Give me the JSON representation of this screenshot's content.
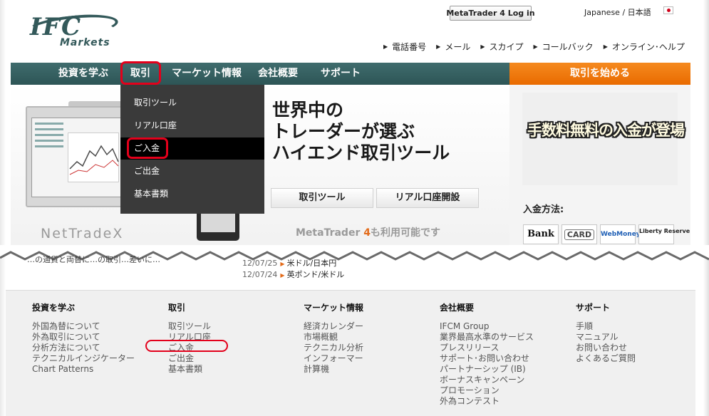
{
  "header": {
    "logo_text": "IFC",
    "logo_subtext": "Markets",
    "mt4_login": "MetaTrader 4 Log in",
    "language": "Japanese / 日本語",
    "top_links": [
      "電話番号",
      "メール",
      "スカイプ",
      "コールバック",
      "オンライン･ヘルプ"
    ]
  },
  "nav": {
    "items": [
      "投資を学ぶ",
      "取引",
      "マーケット情報",
      "会社概要",
      "サポート"
    ],
    "start_trading": "取引を始める"
  },
  "dropdown": {
    "items": [
      "取引ツール",
      "リアル口座",
      "ご入金",
      "ご出金",
      "基本書類"
    ],
    "active_index": 2
  },
  "hero": {
    "headline_lines": [
      "世界中の",
      "トレーダーが選ぶ",
      "ハイエンド取引ツール"
    ],
    "btn_tools": "取引ツール",
    "btn_open_account": "リアル口座開設",
    "platform_name": "NetTradeX",
    "mt4_note_prefix": "MetaTrader ",
    "mt4_note_num": "4",
    "mt4_note_suffix": "も利用可能です"
  },
  "promo": {
    "text": "手数料無料の入金が登場",
    "deposit_methods_label": "入金方法:",
    "methods": [
      "Bank",
      "CARD",
      "WebMoney",
      "Liberty Reserve"
    ]
  },
  "news": {
    "cut_text": "…の通貨と両替に…の取引…差いに…",
    "items": [
      {
        "date": "12/07/25",
        "title": "米ドル/日本円"
      },
      {
        "date": "12/07/24",
        "title": "英ポンド/米ドル"
      }
    ]
  },
  "footer": {
    "columns": [
      {
        "title": "投資を学ぶ",
        "links": [
          "外国為替について",
          "外為取引について",
          "分析方法について",
          "テクニカルインジケーター",
          "Chart Patterns"
        ]
      },
      {
        "title": "取引",
        "links": [
          "取引ツール",
          "リアル口座",
          "ご入金",
          "ご出金",
          "基本書類"
        ]
      },
      {
        "title": "マーケット情報",
        "links": [
          "経済カレンダー",
          "市場概観",
          "テクニカル分析",
          "インフォーマー",
          "計算機"
        ]
      },
      {
        "title": "会社概要",
        "links": [
          "IFCM Group",
          "業界最高水準のサービス",
          "プレスリリース",
          "サポート･お問い合わせ",
          "パートナーシップ (IB)",
          "ボーナスキャンペーン",
          "プロモーション",
          "外為コンテスト"
        ]
      },
      {
        "title": "サポート",
        "links": [
          "手順",
          "マニュアル",
          "お問い合わせ",
          "よくあるご質問"
        ]
      }
    ]
  },
  "colors": {
    "nav_teal": "#33595a",
    "cta_orange": "#e96b00",
    "highlight_red": "#e3001b"
  }
}
